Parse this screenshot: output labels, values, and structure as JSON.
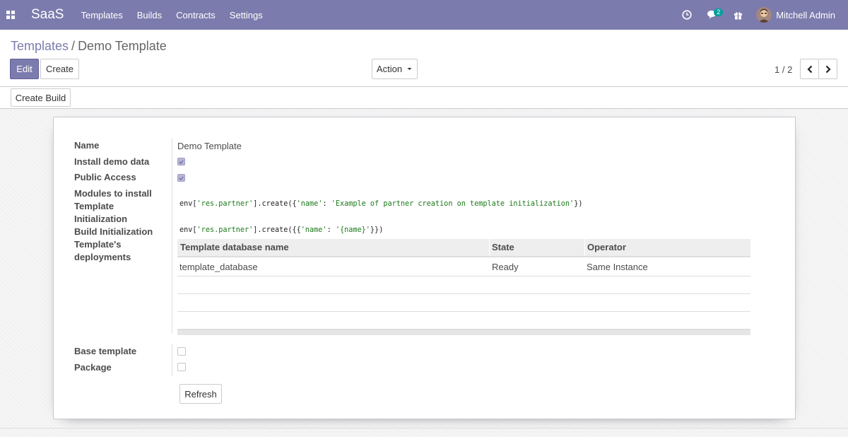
{
  "navbar": {
    "brand": "SaaS",
    "menu": [
      "Templates",
      "Builds",
      "Contracts",
      "Settings"
    ],
    "messages_count": "2",
    "user_name": "Mitchell Admin"
  },
  "breadcrumb": {
    "parent": "Templates",
    "separator": "/",
    "current": "Demo Template"
  },
  "buttons": {
    "edit": "Edit",
    "create": "Create",
    "action": "Action",
    "create_build": "Create Build",
    "refresh": "Refresh"
  },
  "pager": {
    "value": "1 / 2"
  },
  "form": {
    "labels": {
      "name": "Name",
      "install_demo": "Install demo data",
      "public_access": "Public Access",
      "modules": "Modules to install",
      "template_init_1": "Template",
      "template_init_2": "Initialization",
      "build_init": "Build Initialization",
      "deployments_1": "Template's",
      "deployments_2": "deployments",
      "base_template": "Base template",
      "package": "Package"
    },
    "name_value": "Demo Template",
    "install_demo_checked": true,
    "public_access_checked": true,
    "base_template_checked": false,
    "package_checked": false,
    "template_init_code": {
      "prefix": "env[",
      "model": "'res.partner'",
      "mid": "].create({",
      "key": "'name'",
      "colon": ": ",
      "val": "'Example of partner creation on template initialization'",
      "suffix": "})"
    },
    "build_init_code": {
      "prefix": "env[",
      "model": "'res.partner'",
      "mid": "].create({{",
      "key": "'name'",
      "colon": ": ",
      "val": "'{name}'",
      "suffix": "}})"
    }
  },
  "deployments_table": {
    "headers": [
      "Template database name",
      "State",
      "Operator"
    ],
    "rows": [
      [
        "template_database",
        "Ready",
        "Same Instance"
      ]
    ]
  },
  "colors": {
    "navbar": "#7c7bad",
    "primary": "#7c7bad",
    "badge": "#00a09d"
  }
}
